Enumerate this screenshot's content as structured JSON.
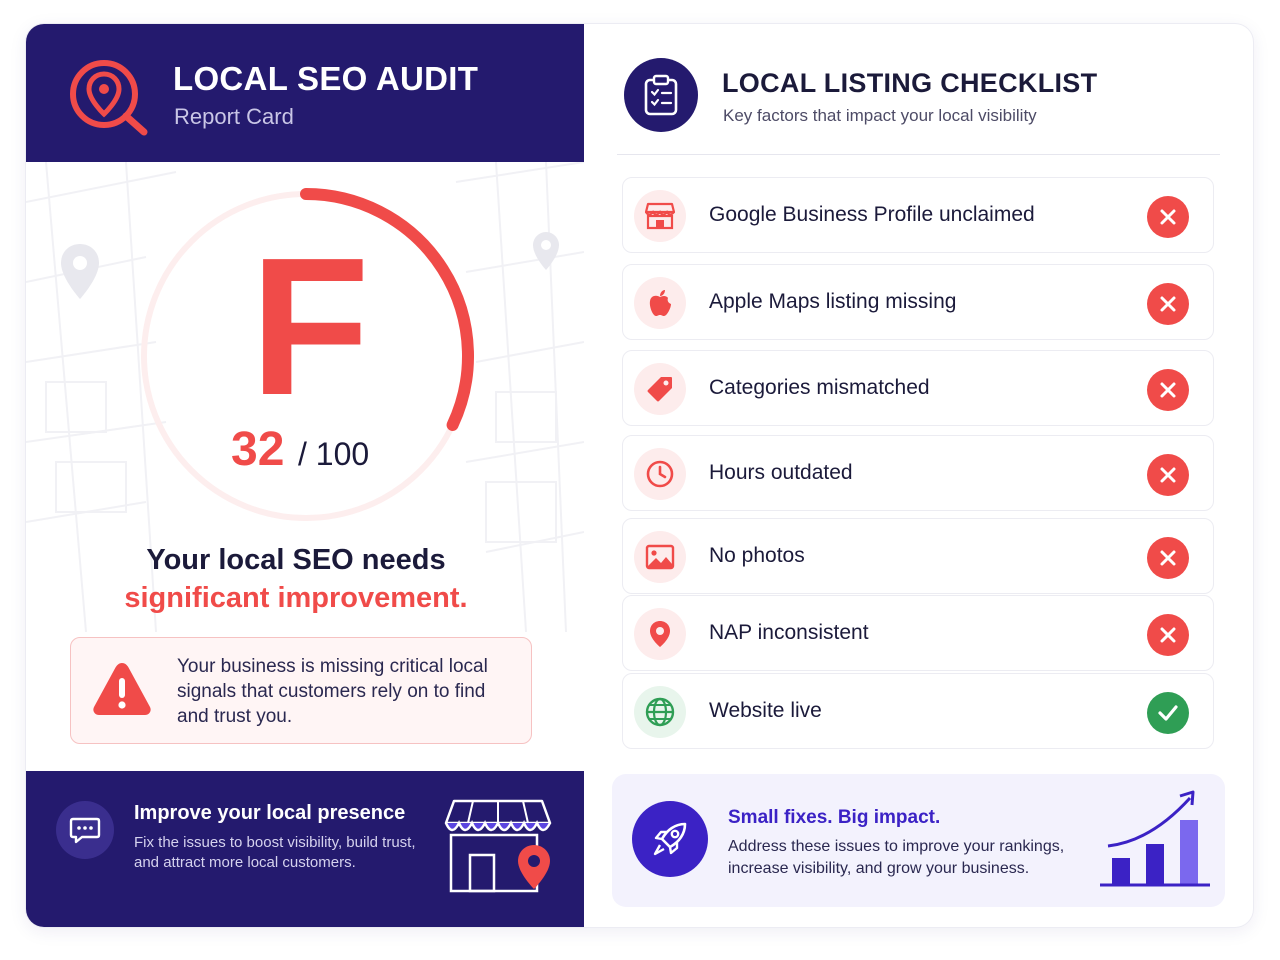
{
  "left": {
    "title": "LOCAL SEO AUDIT",
    "subtitle": "Report Card",
    "grade": "F",
    "score": "32",
    "score_max": "/ 100",
    "score_fraction": 0.32,
    "verdict_line1": "Your local SEO needs",
    "verdict_line2": "significant improvement.",
    "alert_text": "Your business is missing critical local signals that customers rely on to find and trust you.",
    "footer": {
      "title": "Improve your local presence",
      "text": "Fix the issues to boost visibility, build trust, and attract more local customers."
    }
  },
  "right": {
    "title": "LOCAL LISTING CHECKLIST",
    "subtitle": "Key factors that impact your local visibility",
    "items": [
      {
        "label": "Google Business Profile unclaimed",
        "icon": "storefront-icon",
        "status": "fail"
      },
      {
        "label": "Apple Maps listing missing",
        "icon": "apple-icon",
        "status": "fail"
      },
      {
        "label": "Categories mismatched",
        "icon": "tag-icon",
        "status": "fail"
      },
      {
        "label": "Hours outdated",
        "icon": "clock-icon",
        "status": "fail"
      },
      {
        "label": "No photos",
        "icon": "image-icon",
        "status": "fail"
      },
      {
        "label": "NAP inconsistent",
        "icon": "location-pin-icon",
        "status": "fail"
      },
      {
        "label": "Website live",
        "icon": "globe-icon",
        "status": "pass"
      }
    ],
    "impact": {
      "title": "Small fixes. Big impact.",
      "text": "Address these issues to improve your rankings, increase visibility, and grow your business."
    }
  },
  "colors": {
    "navy": "#241a6e",
    "red": "#f04b49",
    "green": "#2f9e55",
    "purple": "#3b22c5"
  }
}
